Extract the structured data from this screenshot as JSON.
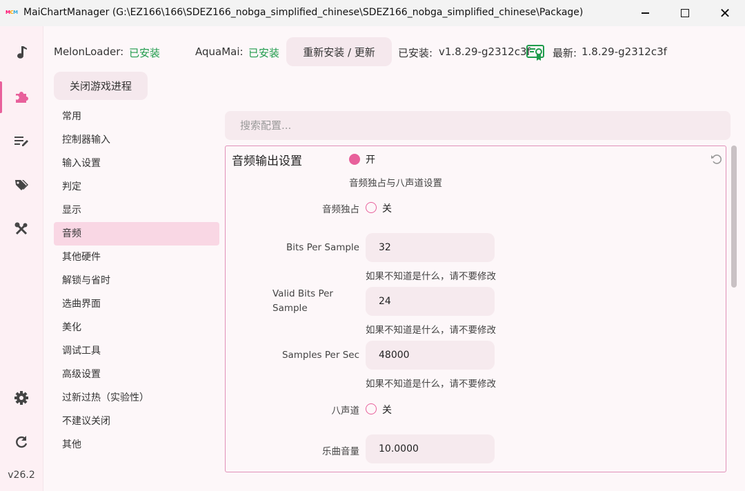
{
  "window": {
    "logo": [
      "M",
      "C",
      "M"
    ],
    "title": "MaiChartManager (G:\\EZ166\\166\\SDEZ166_nobga_simplified_chinese\\SDEZ166_nobga_simplified_chinese\\Package)"
  },
  "sidebar": {
    "icons": [
      "music-note-icon",
      "puzzle-icon",
      "edit-list-icon",
      "tags-icon",
      "tools-icon",
      "gear-icon",
      "refresh-icon"
    ],
    "version": "v26.2"
  },
  "topbar": {
    "melon_label": "MelonLoader:",
    "melon_status": "已安装",
    "aqua_label": "AquaMai:",
    "aqua_status": "已安装",
    "reinstall_button": "重新安装 / 更新",
    "installed_label": "已安装:",
    "installed_version": "v1.8.29-g2312c3f",
    "latest_label": "最新:",
    "latest_version": "1.8.29-g2312c3f",
    "close_game_button": "关闭游戏进程"
  },
  "nav": {
    "items": [
      "常用",
      "控制器输入",
      "输入设置",
      "判定",
      "显示",
      "音频",
      "其他硬件",
      "解锁与省时",
      "选曲界面",
      "美化",
      "调试工具",
      "高级设置",
      "过新过热（实验性）",
      "不建议关闭",
      "其他"
    ],
    "selected": "音频"
  },
  "search": {
    "placeholder": "搜索配置..."
  },
  "panel": {
    "title": "音频输出设置",
    "enabled_label": "开",
    "description": "音频独占与八声道设置",
    "exclusive_label": "音频独占",
    "exclusive_value": "关",
    "bits_label": "Bits Per Sample",
    "bits_value": "32",
    "hint": "如果不知道是什么，请不要修改",
    "valid_bits_label": "Valid Bits Per Sample",
    "valid_bits_value": "24",
    "samples_label": "Samples Per Sec",
    "samples_value": "48000",
    "eight_channel_label": "八声道",
    "eight_channel_value": "关",
    "music_volume_label": "乐曲音量",
    "music_volume_value": "10.0000"
  },
  "colors": {
    "accent": "#e8609b",
    "green": "#1e9b4b"
  }
}
